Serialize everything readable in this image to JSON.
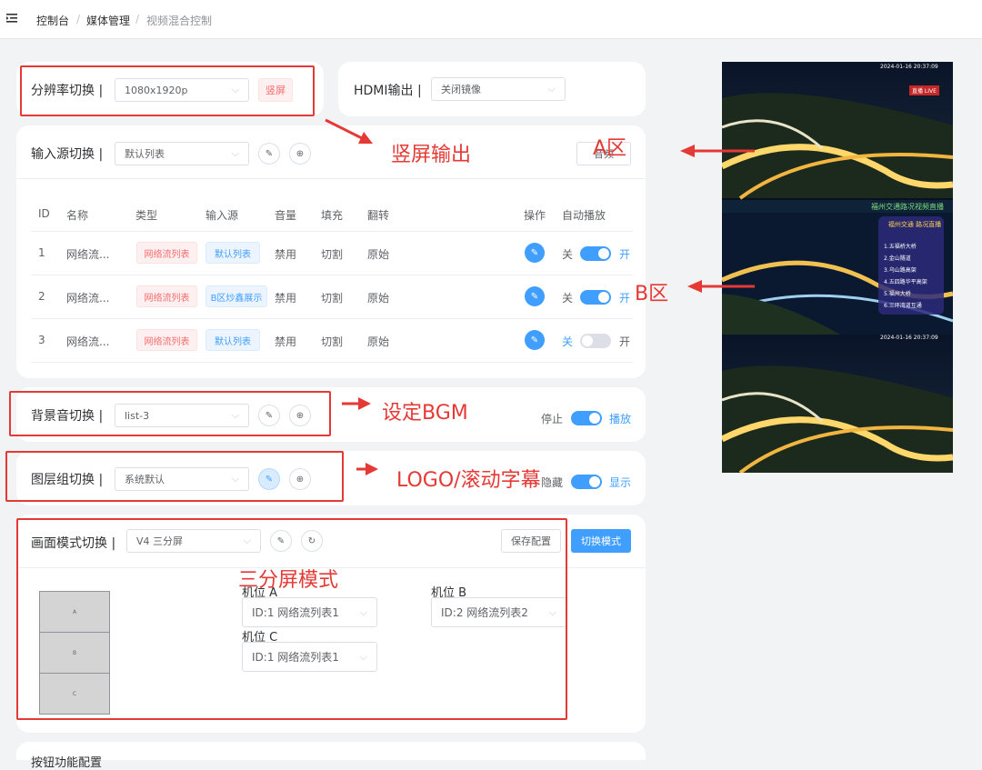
{
  "breadcrumb": {
    "items": [
      "控制台",
      "媒体管理",
      "视频混合控制"
    ],
    "sep": "/"
  },
  "resolution": {
    "label": "分辨率切换 |",
    "value": "1080x1920p",
    "button": "竖屏"
  },
  "hdmi": {
    "label": "HDMI输出 |",
    "value": "关闭镜像"
  },
  "input_source": {
    "label": "输入源切换 |",
    "value": "默认列表",
    "audio_button": "音频",
    "columns": [
      "ID",
      "名称",
      "类型",
      "输入源",
      "音量",
      "填充",
      "翻转",
      "操作",
      "自动播放"
    ],
    "rows": [
      {
        "id": "1",
        "name": "网络流...",
        "type": "网络流列表",
        "source": "默认列表",
        "volume": "禁用",
        "fill": "切割",
        "flip": "原始",
        "off": "关",
        "on": "开",
        "enabled": true
      },
      {
        "id": "2",
        "name": "网络流...",
        "type": "网络流列表",
        "source": "B区炒鑫展示",
        "volume": "禁用",
        "fill": "切割",
        "flip": "原始",
        "off": "关",
        "on": "开",
        "enabled": true
      },
      {
        "id": "3",
        "name": "网络流...",
        "type": "网络流列表",
        "source": "默认列表",
        "volume": "禁用",
        "fill": "切割",
        "flip": "原始",
        "off": "关",
        "on": "开",
        "enabled": false
      }
    ]
  },
  "bgm": {
    "label": "背景音切换 |",
    "value": "list-3",
    "stop": "停止",
    "play": "播放"
  },
  "layer": {
    "label": "图层组切换 |",
    "value": "系统默认",
    "hide": "隐藏",
    "show": "显示"
  },
  "screen_mode": {
    "label": "画面模式切换 |",
    "value": "V4 三分屏",
    "save": "保存配置",
    "switch": "切换模式",
    "blocks": [
      "A",
      "B",
      "C"
    ],
    "cams": [
      {
        "label": "机位 A",
        "value": "ID:1 网络流列表1"
      },
      {
        "label": "机位 B",
        "value": "ID:2 网络流列表2"
      },
      {
        "label": "机位 C",
        "value": "ID:1 网络流列表1"
      }
    ]
  },
  "bottom_card": {
    "label": "按钮功能配置"
  },
  "annotations": {
    "portrait": "竖屏输出",
    "zone_a": "A区",
    "zone_b": "B区",
    "bgm": "设定BGM",
    "logo": "LOGO/滚动字幕",
    "tri": "三分屏模式"
  },
  "video": {
    "timestamp_top": "2024-01-16 20:37:09",
    "live_badge": "直播 LIVE",
    "banner": "福州交通路况视频直播",
    "timestamp_mid": "2024-01-16 20:37:09",
    "menu_title": "福州交通 路况直播",
    "menu_items": [
      "1.五福桥大桥",
      "2.金山隧道",
      "3.乌山路高架",
      "4.五四路华平高架",
      "5.福州大桥",
      "6.三环湾道互通"
    ]
  },
  "colors": {
    "primary": "#409eff",
    "danger": "#f56c6c",
    "annotation": "#e53935"
  }
}
